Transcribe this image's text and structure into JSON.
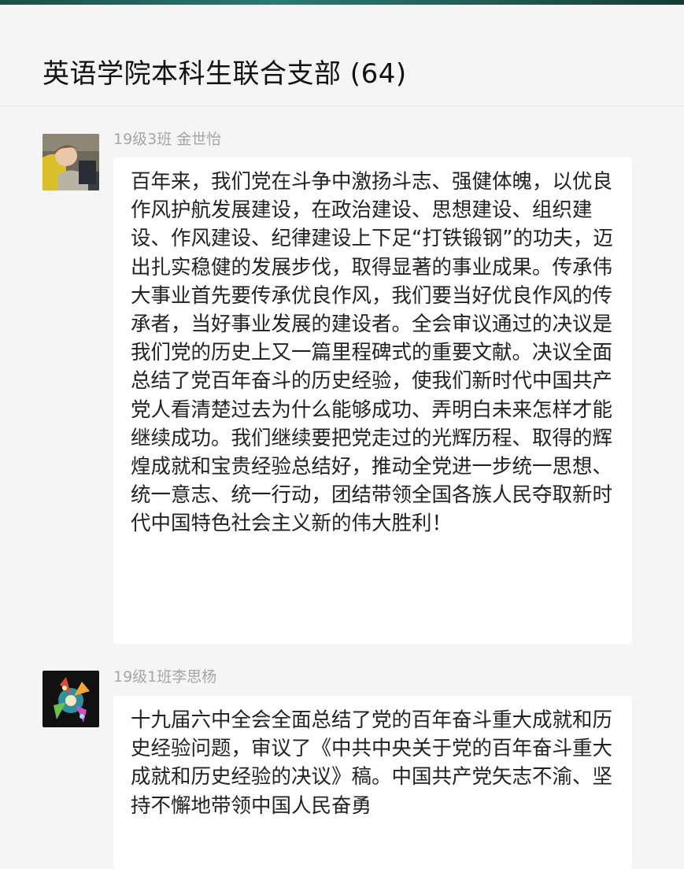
{
  "chat": {
    "title": "英语学院本科生联合支部 (64)"
  },
  "messages": [
    {
      "sender": "19级3班 金世怡",
      "avatar_icon": "user-photo-avatar",
      "text": "百年来，我们党在斗争中激扬斗志、强健体魄，以优良作风护航发展建设，在政治建设、思想建设、组织建设、作风建设、纪律建设上下足“打铁锻钢”的功夫，迈出扎实稳健的发展步伐，取得显著的事业成果。传承伟大事业首先要传承优良作风，我们要当好优良作风的传承者，当好事业发展的建设者。全会审议通过的决议是我们党的历史上又一篇里程碑式的重要文献。决议全面总结了党百年奋斗的历史经验，使我们新时代中国共产党人看清楚过去为什么能够成功、弄明白未来怎样才能继续成功。我们继续要把党走过的光辉历程、取得的辉煌成就和宝贵经验总结好，推动全党进一步统一思想、统一意志、统一行动，团结带领全国各族人民夺取新时代中国特色社会主义新的伟大胜利！"
    },
    {
      "sender": "19级1班李思杨",
      "avatar_icon": "colorful-art-avatar",
      "text": "十九届六中全会全面总结了党的百年奋斗重大成就和历史经验问题，审议了《中共中央关于党的百年奋斗重大成就和历史经验的决议》稿。中国共产党矢志不渝、坚持不懈地带领中国人民奋勇"
    }
  ]
}
